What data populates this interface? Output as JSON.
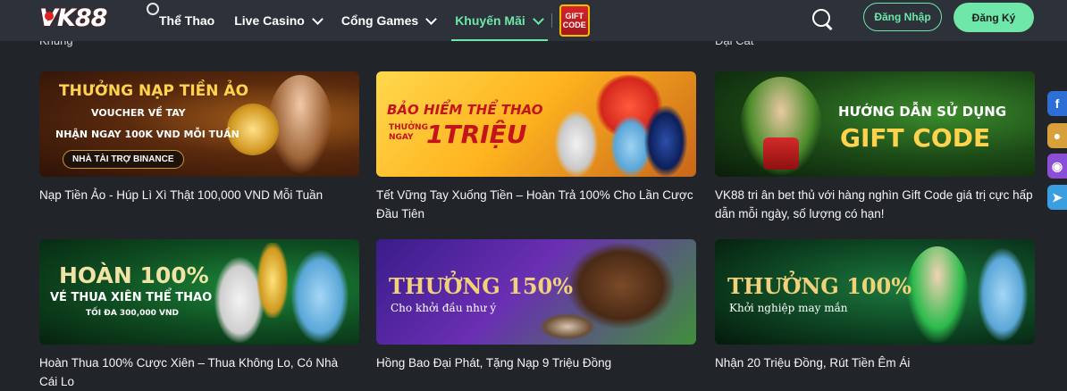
{
  "header": {
    "logo_text": "VK88",
    "nav": [
      {
        "label": "Thể Thao"
      },
      {
        "label": "Live Casino"
      },
      {
        "label": "Cổng Games"
      },
      {
        "label": "Khuyến Mãi"
      }
    ],
    "gift_badge": {
      "line1": "GIFT",
      "line2": "CODE"
    },
    "login_label": "Đăng Nhập",
    "register_label": "Đăng Ký",
    "accent_color": "#6ee7a8"
  },
  "peek_text": {
    "left": "Khủng",
    "right": "Đại Cát"
  },
  "promos": [
    {
      "title": "Nạp Tiền Ảo - Húp Lì Xì Thật 100,000 VND Mỗi Tuần",
      "banner": {
        "line1": "THƯỞNG NẠP TIỀN ẢO",
        "line2": "VOUCHER VỀ TAY",
        "line3": "NHẬN NGAY 100K VND MỖI TUẦN",
        "sponsor": "NHÀ TÀI TRỢ BINANCE"
      }
    },
    {
      "title": "Tết Vững Tay Xuống Tiền – Hoàn Trả 100% Cho Lần Cược Đầu Tiên",
      "banner": {
        "line1": "BẢO HIỂM THỂ THAO",
        "line2": "THƯỞNG NGAY",
        "line3": "1TRIỆU"
      }
    },
    {
      "title": "VK88 tri ân bet thủ với hàng nghìn Gift Code giá trị cực hấp dẫn mỗi ngày, số lượng có hạn!",
      "banner": {
        "line1": "HƯỚNG DẪN SỬ DỤNG",
        "line2": "GIFT CODE"
      }
    },
    {
      "title": "Hoàn Thua 100% Cược Xiên – Thua Không Lo, Có Nhà Cái Lo",
      "banner": {
        "line1": "HOÀN 100%",
        "line2": "VÉ THUA XIÊN THỂ THAO",
        "line3": "TỐI ĐA 300,000 VND"
      }
    },
    {
      "title": "Hồng Bao Đại Phát, Tặng Nạp 9 Triệu Đồng",
      "banner": {
        "line1": "THƯỞNG 150%",
        "line2": "Cho khởi đầu như ý"
      }
    },
    {
      "title": "Nhận 20 Triệu Đồng, Rút Tiền Êm Ái",
      "banner": {
        "line1": "THƯỞNG 100%",
        "line2": "Khởi nghiệp may mắn"
      }
    }
  ],
  "side_icons": [
    "facebook-icon",
    "group-icon",
    "messenger-icon",
    "telegram-icon"
  ]
}
